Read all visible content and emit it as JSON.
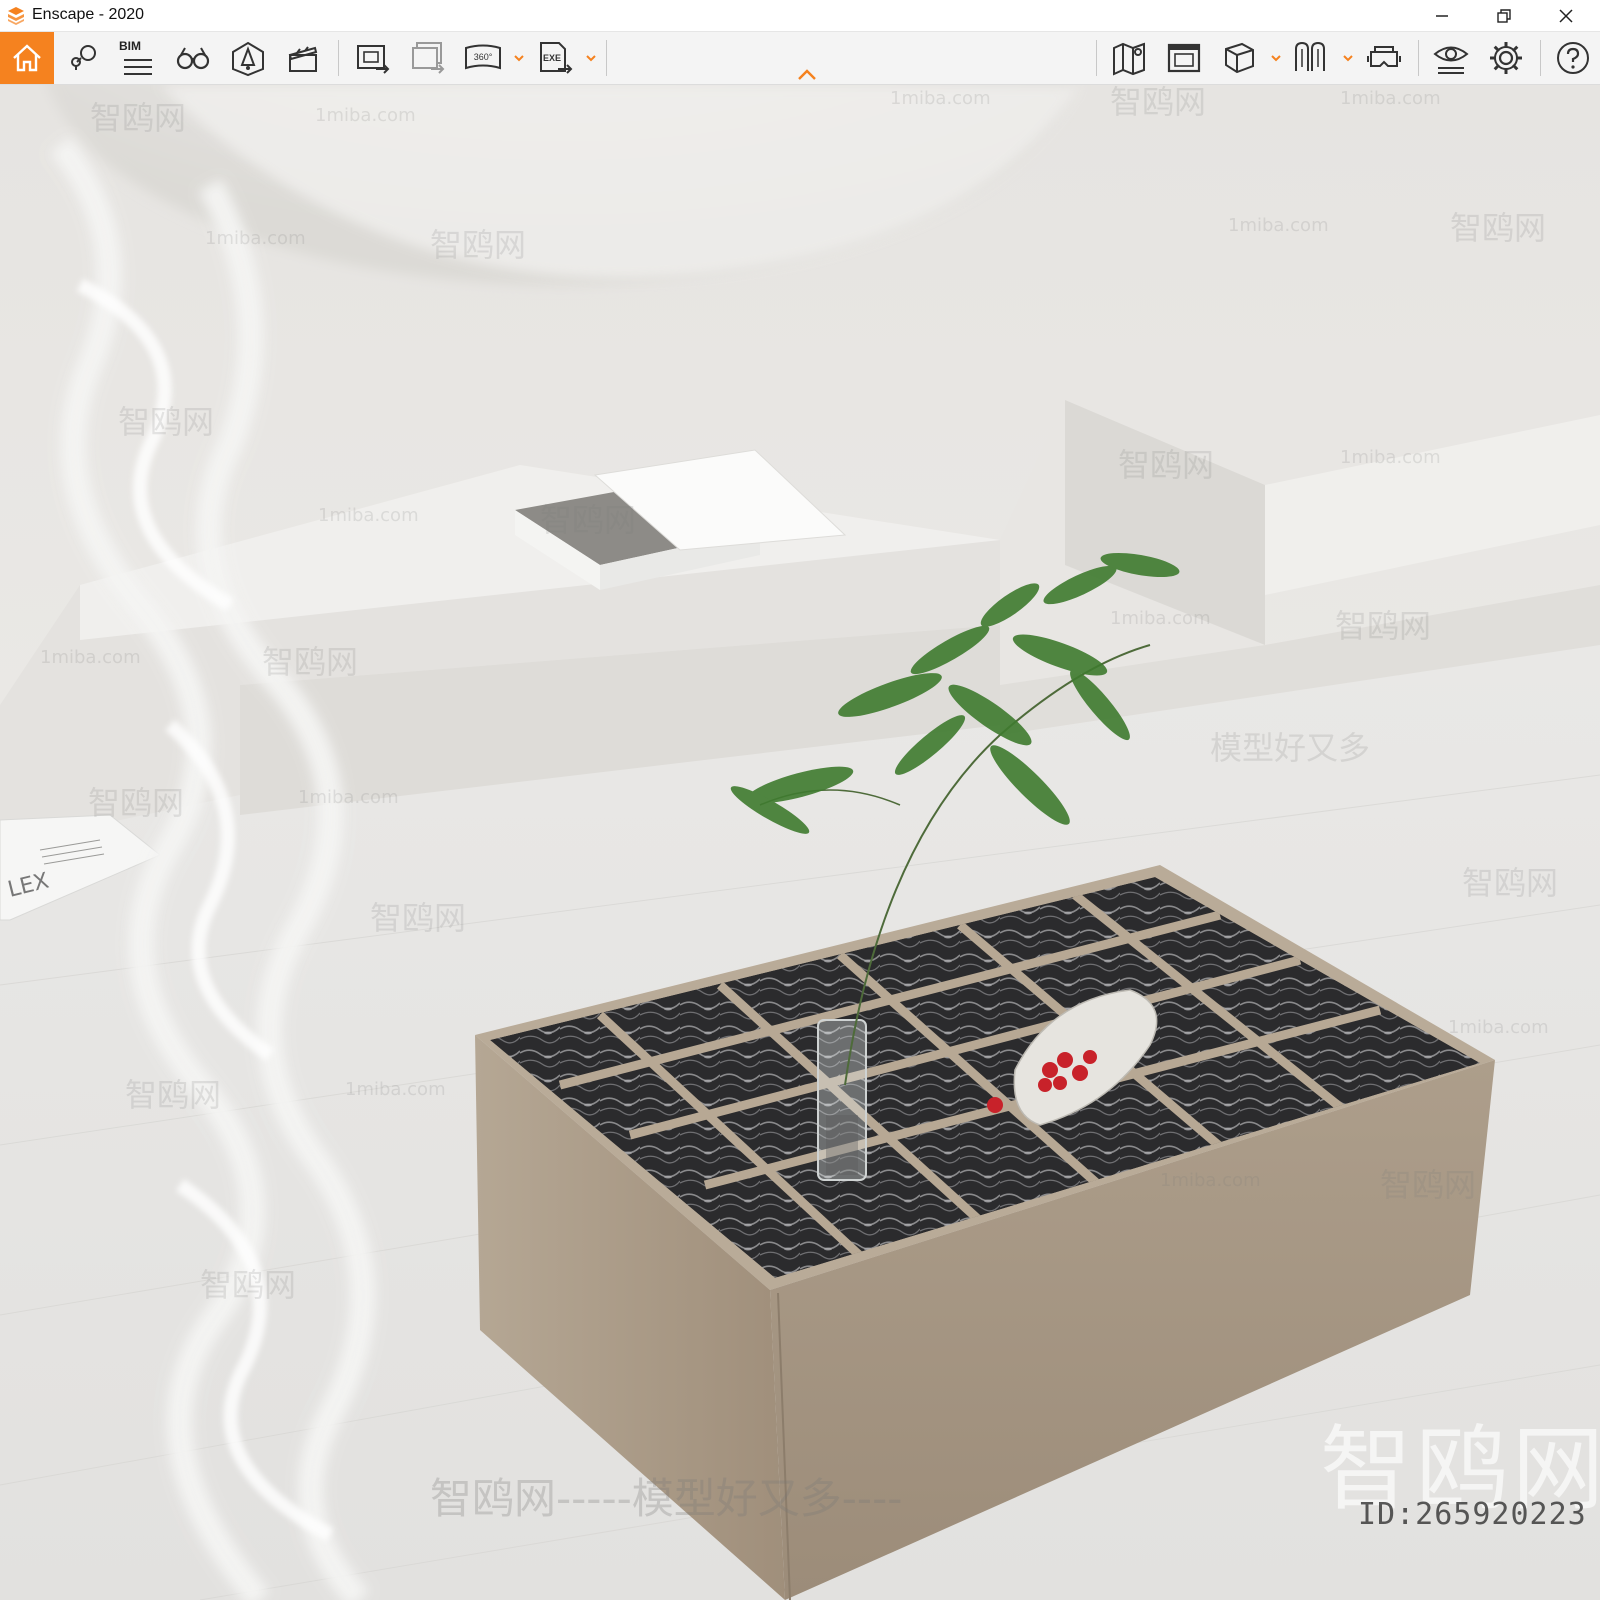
{
  "window": {
    "title": "Enscape - 2020",
    "accent_color": "#f5821f"
  },
  "toolbar": {
    "bim_label": "BIM",
    "exe_label": "EXE",
    "pano_label": "360°",
    "left_tools": [
      "home-icon",
      "asset-library-icon",
      "bim-icon",
      "binoculars-icon",
      "light-view-icon",
      "video-editor-icon",
      "render-screenshot-icon",
      "batch-render-icon",
      "panorama-icon",
      "exe-export-icon"
    ],
    "right_tools": [
      "map-icon",
      "material-editor-icon",
      "view-cube-icon",
      "bim-info-icon",
      "vr-headset-icon",
      "visual-settings-icon",
      "settings-icon",
      "help-icon"
    ]
  },
  "watermarks": {
    "site": "1miba.com",
    "brand_cn": "智鸥网",
    "slogan_cn": "模型好又多",
    "big": "智鸥网",
    "id_text": "ID:265920223",
    "bottom_line": "智鸥网-----模型好又多----"
  },
  "scene_colors": {
    "table": "#a89a88",
    "wall": "#ecebe8",
    "floor": "#e8e7e5",
    "fern": "#3f7b2f",
    "cherries": "#c8222a"
  }
}
